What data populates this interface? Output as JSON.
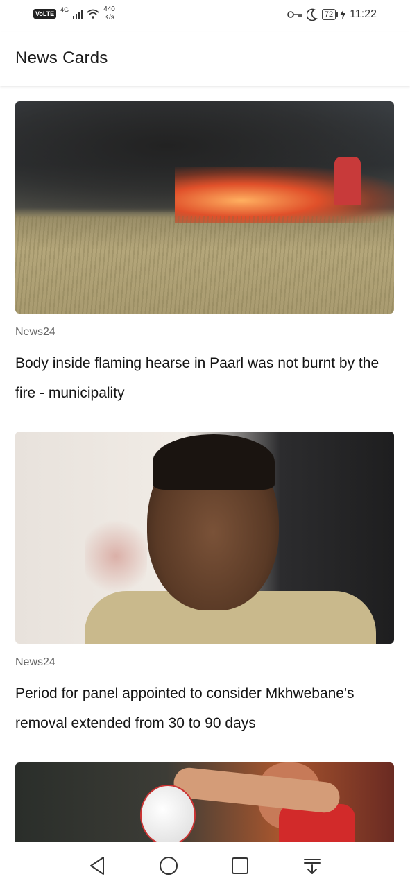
{
  "status_bar": {
    "volte": "VoLTE",
    "network": "4G",
    "speed_value": "440",
    "speed_unit": "K/s",
    "battery": "72",
    "time": "11:22",
    "icons": [
      "signal-icon",
      "wifi-icon",
      "key-icon",
      "moon-icon",
      "battery-icon",
      "charging-icon"
    ]
  },
  "app_bar": {
    "title": "News Cards"
  },
  "cards": [
    {
      "source": "News24",
      "headline": "Body inside flaming hearse in Paarl was not burnt by the fire - municipality"
    },
    {
      "source": "News24",
      "headline": "Period for panel appointed to consider Mkhwebane's removal extended from 30 to 90 days"
    },
    {
      "source": "",
      "headline": ""
    }
  ],
  "nav_bar": {
    "icons": [
      "back-icon",
      "home-icon",
      "recents-icon",
      "notification-drawer-icon"
    ]
  }
}
